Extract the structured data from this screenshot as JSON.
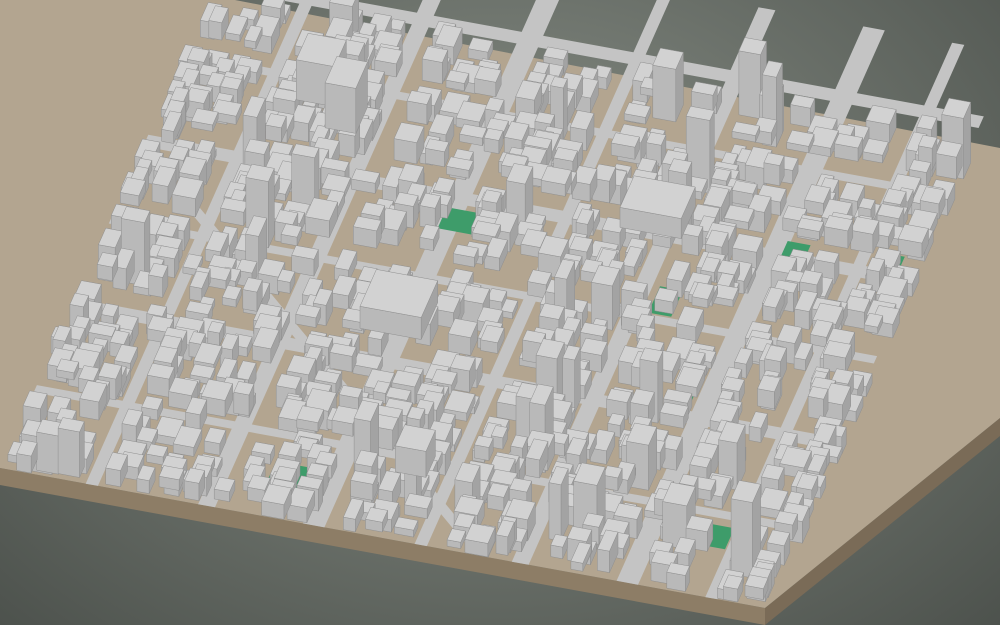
{
  "scene": {
    "kind": "3d-city-block-model",
    "colors": {
      "background_center": "#8b9188",
      "background_edge": "#4d524d",
      "ground": "#b3a590",
      "base_side_front": "#8d7d66",
      "base_side_right": "#7a6b57",
      "building_roof": "#d2d2d2",
      "building_front": "#b9b9b9",
      "building_side": "#a3a3a3",
      "building_edge": "#8f8f8f",
      "park": "#3e9c6a",
      "water": "#8fc3d6",
      "road": "#c4c4c4"
    },
    "features": [
      "building-blocks",
      "road-network",
      "green-parks",
      "plaza-areas",
      "model-base"
    ]
  }
}
